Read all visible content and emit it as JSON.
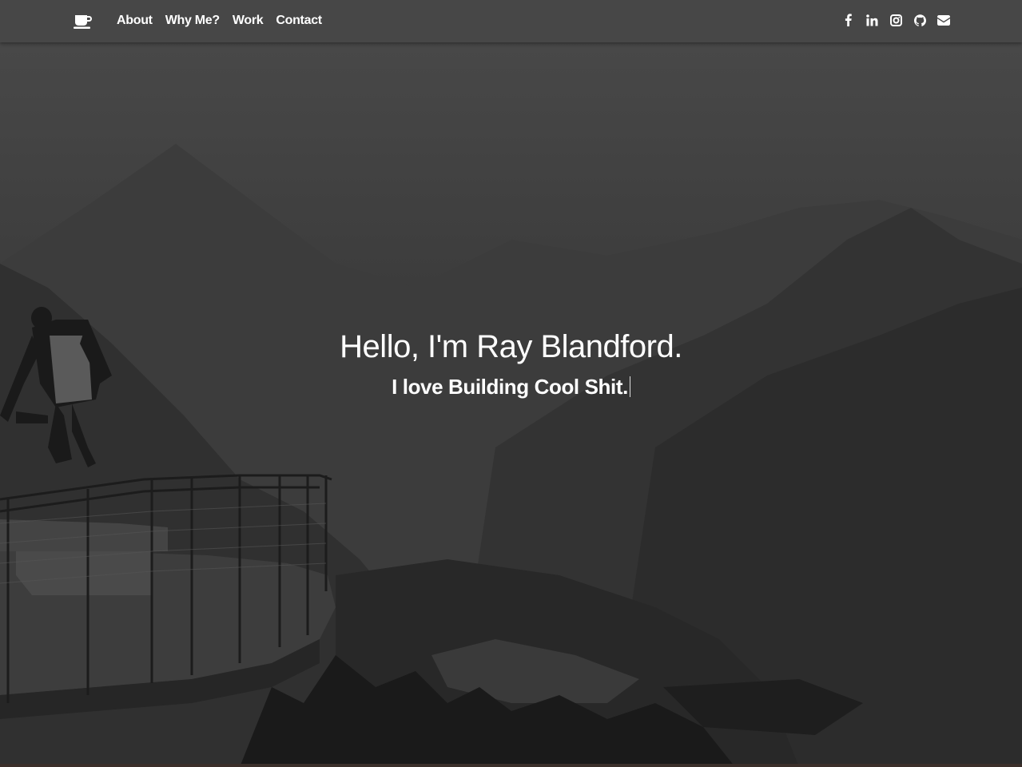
{
  "nav": {
    "brand_icon": "coffee-cup-icon",
    "links": [
      "About",
      "Why Me?",
      "Work",
      "Contact"
    ],
    "social_icons": [
      "facebook-icon",
      "linkedin-icon",
      "instagram-icon",
      "github-icon",
      "envelope-icon"
    ]
  },
  "hero": {
    "title": "Hello, I'm Ray Blandford.",
    "subtitle": "I love Building Cool Shit."
  },
  "colors": {
    "navbar": "#474747",
    "text": "#ffffff",
    "overlay": "#2f2f2f"
  }
}
